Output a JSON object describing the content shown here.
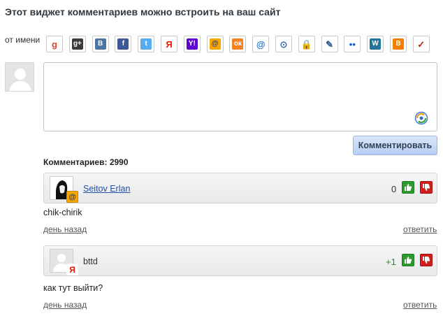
{
  "header": {
    "title": "Этот виджет комментариев можно встроить на ваш сайт"
  },
  "auth": {
    "label": "от имени",
    "providers": [
      {
        "name": "google",
        "glyph": "g",
        "bg": "#ffffff",
        "fg": "#db4437"
      },
      {
        "name": "google-plus",
        "glyph": "g+",
        "bg": "#3b3b3b",
        "fg": "#ffffff"
      },
      {
        "name": "vkontakte",
        "glyph": "B",
        "bg": "#4c75a3",
        "fg": "#ffffff"
      },
      {
        "name": "facebook",
        "glyph": "f",
        "bg": "#3b5998",
        "fg": "#ffffff"
      },
      {
        "name": "twitter",
        "glyph": "t",
        "bg": "#55acee",
        "fg": "#ffffff"
      },
      {
        "name": "yandex",
        "glyph": "Я",
        "bg": "#ffffff",
        "fg": "#e61400"
      },
      {
        "name": "yahoo",
        "glyph": "Y!",
        "bg": "#5f01d1",
        "fg": "#ffffff"
      },
      {
        "name": "mail-ru",
        "glyph": "@",
        "bg": "#f7a600",
        "fg": "#1c3d8c"
      },
      {
        "name": "odnoklassniki",
        "glyph": "ок",
        "bg": "#f58220",
        "fg": "#ffffff"
      },
      {
        "name": "email",
        "glyph": "@",
        "bg": "#ffffff",
        "fg": "#1a73c9"
      },
      {
        "name": "rambler",
        "glyph": "⊙",
        "bg": "#ffffff",
        "fg": "#3a6fb0"
      },
      {
        "name": "openid",
        "glyph": "🔒",
        "bg": "#ffffff",
        "fg": "#444444"
      },
      {
        "name": "livejournal",
        "glyph": "✎",
        "bg": "#ffffff",
        "fg": "#2c5c8c"
      },
      {
        "name": "flickr",
        "glyph": "••",
        "bg": "#ffffff",
        "fg": "#0063dc"
      },
      {
        "name": "wordpress",
        "glyph": "W",
        "bg": "#21759b",
        "fg": "#ffffff"
      },
      {
        "name": "blogger",
        "glyph": "B",
        "bg": "#f57d00",
        "fg": "#ffffff"
      },
      {
        "name": "checkmark",
        "glyph": "✓",
        "bg": "#ffffff",
        "fg": "#c0221a"
      }
    ]
  },
  "form": {
    "textarea_value": "",
    "submit_label": "Комментировать"
  },
  "comments_count": {
    "label": "Комментариев:",
    "value": "2990"
  },
  "comments": [
    {
      "author": "Seitov Erlan",
      "author_is_link": true,
      "provider_badge": "@",
      "score": "0",
      "score_color": "#333333",
      "text": "chik-chirik",
      "time": "день назад",
      "reply_label": "ответить"
    },
    {
      "author": "bttd",
      "author_is_link": false,
      "provider_badge": "Я",
      "score": "+1",
      "score_color": "#2e8b2e",
      "text": "как тут выйти?",
      "time": "день назад",
      "reply_label": "ответить"
    }
  ]
}
